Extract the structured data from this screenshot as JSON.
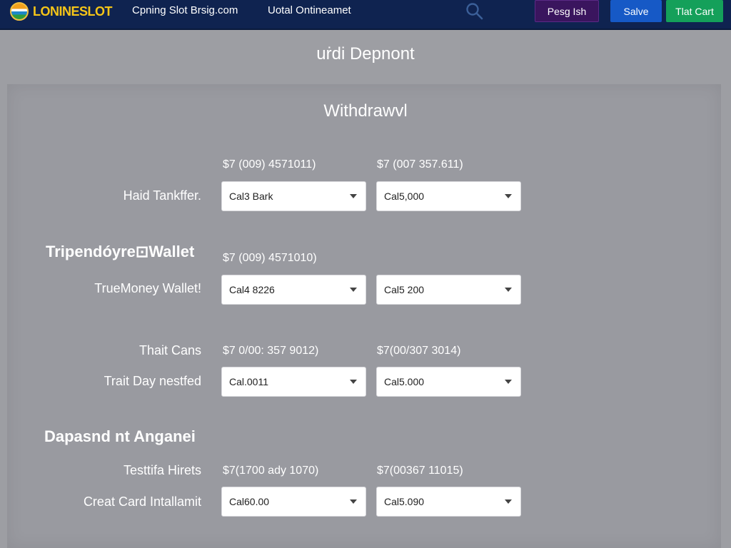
{
  "header": {
    "logo_text": "LONINESLOT",
    "links": [
      "Cpning Slot Brsig.com",
      "Uotal Ontineamet"
    ],
    "buttons": [
      "Pesg Ish",
      "Salve",
      "Tlat Cart"
    ],
    "colors": {
      "nav_bg": "#0f2350",
      "logo": "#f5c518",
      "btn1": "#3a155e",
      "btn2": "#1659c6",
      "btn3": "#14a05a"
    }
  },
  "page_title": "uṙdi Depnont",
  "section_title": "Withdrawvl",
  "rows": [
    {
      "amount1": "$7 (009) 4571011)",
      "amount2": "$7 (007 357.611)",
      "label": "Haid Tankffer.",
      "select1": "Cal3 Bark",
      "select2": "Cal5,000"
    },
    {
      "group_title": "Tripendóyre⊡Wallet",
      "amount1": "$7 (009) 4571010)",
      "label": "TrueMoney Wallet!",
      "select1": "Cal4 8226",
      "select2": "Cal5 200"
    },
    {
      "pre_label": "Thait Cans",
      "amount1": "$7 0/00: 357 9012)",
      "amount2": "$7(00/307 3014)",
      "label": "Trait Day nestfed",
      "select1": "Cal.0011",
      "select2": "Cal5.000"
    },
    {
      "group_title": "Dapasnd nt Anganei",
      "pre_label": "Testtifa Hirets",
      "amount1": "$7(1700 ady 1070)",
      "amount2": "$7(00367 11015)",
      "label": "Creat Card Intallamit",
      "select1": "Cal60.00",
      "select2": "Cal5.090"
    }
  ]
}
